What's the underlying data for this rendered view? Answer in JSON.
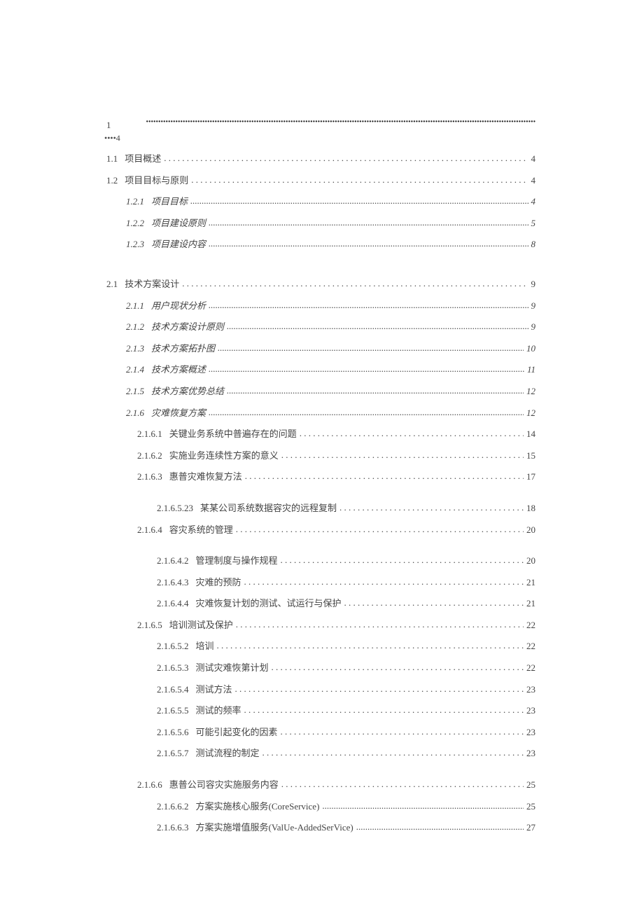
{
  "header": {
    "num": "1",
    "sub": "••••4"
  },
  "entries": [
    {
      "num": "1.1",
      "title": "项目概述",
      "page": "4",
      "cls": "lvl1",
      "leader": "leader"
    },
    {
      "num": "1.2",
      "title": "项目目标与原则",
      "page": "4",
      "cls": "lvl1",
      "leader": "leader"
    },
    {
      "num": "1.2.1",
      "title": "项目目标",
      "page": "4",
      "cls": "lvl2 italic",
      "leader": "leader-tight"
    },
    {
      "num": "1.2.2",
      "title": "项目建设原则",
      "page": "5",
      "cls": "lvl2 italic",
      "leader": "leader-tight"
    },
    {
      "num": "1.2.3",
      "title": "项目建设内容",
      "page": "8",
      "cls": "lvl2 italic",
      "leader": "leader-tight"
    },
    {
      "num": "2.1",
      "title": "技术方案设计",
      "page": "9",
      "cls": "lvl1 gap-lg",
      "leader": "leader"
    },
    {
      "num": "2.1.1",
      "title": "用户现状分析",
      "page": "9",
      "cls": "lvl2 italic",
      "leader": "leader-tight"
    },
    {
      "num": "2.1.2",
      "title": "技术方案设计原则",
      "page": "9",
      "cls": "lvl2 italic",
      "leader": "leader-tight"
    },
    {
      "num": "2.1.3",
      "title": "技术方案拓扑图",
      "page": "10",
      "cls": "lvl2 italic",
      "leader": "leader-tight"
    },
    {
      "num": "2.1.4",
      "title": "技术方案概述",
      "page": "11",
      "cls": "lvl2 italic",
      "leader": "leader-tight"
    },
    {
      "num": "2.1.5",
      "title": "技术方案优势总结",
      "page": "12",
      "cls": "lvl2 italic",
      "leader": "leader-tight"
    },
    {
      "num": "2.1.6",
      "title": "灾难恢复方案",
      "page": "12",
      "cls": "lvl2 italic",
      "leader": "leader-tight"
    },
    {
      "num": "2.1.6.1",
      "title": "关键业务系统中普遍存在的问题",
      "page": "14",
      "cls": "lvl3",
      "leader": "leader"
    },
    {
      "num": "2.1.6.2",
      "title": "实施业务连续性方案的意义",
      "page": "15",
      "cls": "lvl3",
      "leader": "leader"
    },
    {
      "num": "2.1.6.3",
      "title": "惠普灾难恢复方法",
      "page": "17",
      "cls": "lvl3",
      "leader": "leader"
    },
    {
      "num": "2.1.6.5.23",
      "title": "某某公司系统数据容灾的远程复制",
      "page": "18",
      "cls": "lvl4 gap-md",
      "leader": "leader"
    },
    {
      "num": "2.1.6.4",
      "title": "容灾系统的管理",
      "page": "20",
      "cls": "lvl3",
      "leader": "leader"
    },
    {
      "num": "2.1.6.4.2",
      "title": "管理制度与操作规程",
      "page": "20",
      "cls": "lvl4 gap-md",
      "leader": "leader"
    },
    {
      "num": "2.1.6.4.3",
      "title": "灾难的预防",
      "page": "21",
      "cls": "lvl4",
      "leader": "leader"
    },
    {
      "num": "2.1.6.4.4",
      "title": "灾难恢复计划的测试、试运行与保护",
      "page": "21",
      "cls": "lvl4",
      "leader": "leader"
    },
    {
      "num": "2.1.6.5",
      "title": "培训测试及保护",
      "page": "22",
      "cls": "lvl3",
      "leader": "leader"
    },
    {
      "num": "2.1.6.5.2",
      "title": "培训",
      "page": "22",
      "cls": "lvl4",
      "leader": "leader"
    },
    {
      "num": "2.1.6.5.3",
      "title": "测试灾难恢第计划",
      "page": "22",
      "cls": "lvl4",
      "leader": "leader"
    },
    {
      "num": "2.1.6.5.4",
      "title": "测试方法",
      "page": "23",
      "cls": "lvl4",
      "leader": "leader"
    },
    {
      "num": "2.1.6.5.5",
      "title": "测试的频率",
      "page": "23",
      "cls": "lvl4",
      "leader": "leader"
    },
    {
      "num": "2.1.6.5.6",
      "title": "可能引起变化的因素",
      "page": "23",
      "cls": "lvl4",
      "leader": "leader"
    },
    {
      "num": "2.1.6.5.7",
      "title": "测试流程的制定",
      "page": "23",
      "cls": "lvl4",
      "leader": "leader"
    },
    {
      "num": "2.1.6.6",
      "title": "惠普公司容灾实施服务内容",
      "page": "25",
      "cls": "lvl3 gap-md",
      "leader": "leader"
    },
    {
      "num": "2.1.6.6.2",
      "title": "方案实施核心服务(CoreService)",
      "page": "25",
      "cls": "lvl4",
      "leader": "leader-tight"
    },
    {
      "num": "2.1.6.6.3",
      "title": "方案实施增值服务(ValUe-AddedSerVice)",
      "page": "27",
      "cls": "lvl4",
      "leader": "leader-tight"
    }
  ]
}
